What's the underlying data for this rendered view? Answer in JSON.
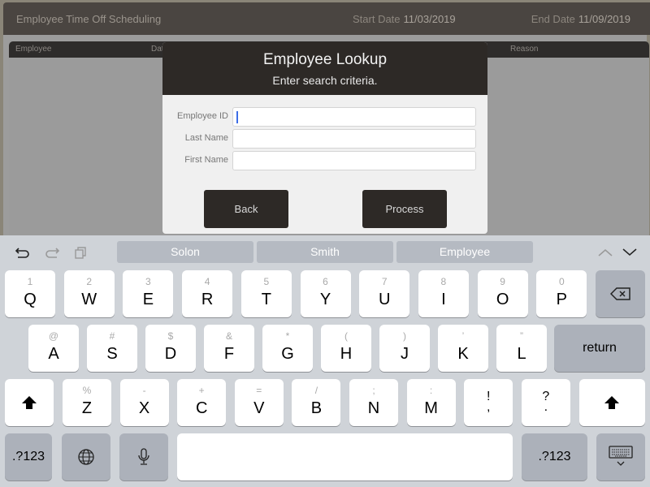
{
  "app": {
    "title": "Employee Time Off Scheduling",
    "start_date_label": "Start Date",
    "start_date_value": "11/03/2019",
    "end_date_label": "End Date",
    "end_date_value": "11/09/2019",
    "grid_columns": [
      "Employee",
      "Date",
      "Reason"
    ]
  },
  "modal": {
    "title": "Employee Lookup",
    "subtitle": "Enter search criteria.",
    "fields": [
      {
        "label": "Employee ID",
        "value": "",
        "focused": true
      },
      {
        "label": "Last Name",
        "value": ""
      },
      {
        "label": "First Name",
        "value": ""
      }
    ],
    "back_label": "Back",
    "process_label": "Process"
  },
  "keyboard": {
    "toolbar_icons": [
      "undo-icon",
      "redo-icon",
      "paste-icon"
    ],
    "suggestions": [
      "Solon",
      "Smith",
      "Employee"
    ],
    "nav_icons": [
      "chevron-up-icon",
      "chevron-down-icon"
    ],
    "row1": [
      {
        "pri": "Q",
        "sec": "1"
      },
      {
        "pri": "W",
        "sec": "2"
      },
      {
        "pri": "E",
        "sec": "3"
      },
      {
        "pri": "R",
        "sec": "4"
      },
      {
        "pri": "T",
        "sec": "5"
      },
      {
        "pri": "Y",
        "sec": "6"
      },
      {
        "pri": "U",
        "sec": "7"
      },
      {
        "pri": "I",
        "sec": "8"
      },
      {
        "pri": "O",
        "sec": "9"
      },
      {
        "pri": "P",
        "sec": "0"
      }
    ],
    "row2": [
      {
        "pri": "A",
        "sec": "@"
      },
      {
        "pri": "S",
        "sec": "#"
      },
      {
        "pri": "D",
        "sec": "$"
      },
      {
        "pri": "F",
        "sec": "&"
      },
      {
        "pri": "G",
        "sec": "*"
      },
      {
        "pri": "H",
        "sec": "("
      },
      {
        "pri": "J",
        "sec": ")"
      },
      {
        "pri": "K",
        "sec": "’"
      },
      {
        "pri": "L",
        "sec": "”"
      }
    ],
    "return_label": "return",
    "row3": [
      {
        "pri": "Z",
        "sec": "%"
      },
      {
        "pri": "X",
        "sec": "-"
      },
      {
        "pri": "C",
        "sec": "+"
      },
      {
        "pri": "V",
        "sec": "="
      },
      {
        "pri": "B",
        "sec": "/"
      },
      {
        "pri": "N",
        "sec": ";"
      },
      {
        "pri": "M",
        "sec": ":"
      },
      {
        "pri": ",",
        "sec": "!"
      },
      {
        "pri": ".",
        "sec": "?"
      }
    ],
    "numbers_label": ".?123",
    "space_label": ""
  }
}
